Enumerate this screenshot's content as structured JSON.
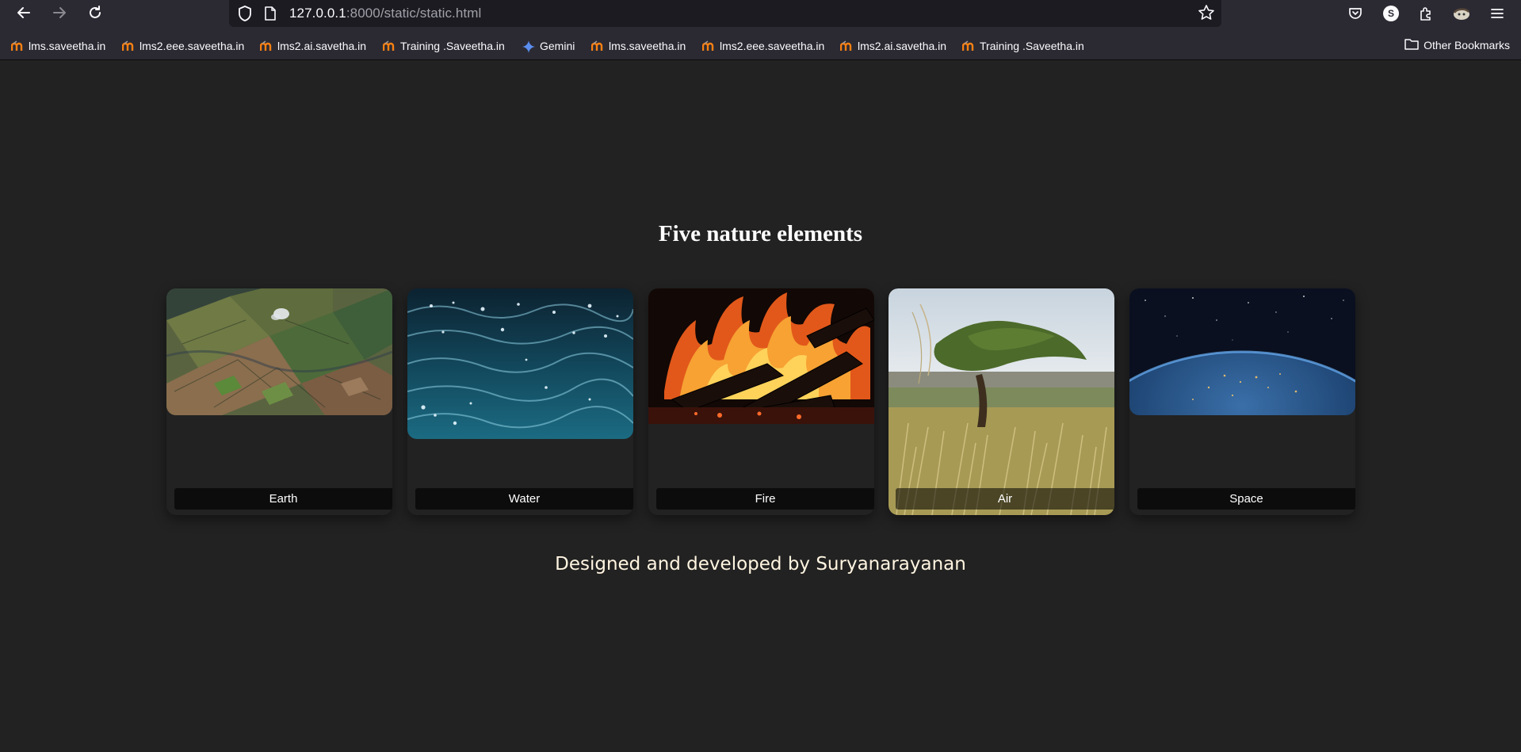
{
  "browser": {
    "url_host": "127.0.0.1",
    "url_rest": ":8000/static/static.html",
    "profile_initial": "S",
    "bookmarks": [
      {
        "label": "lms.saveetha.in",
        "icon": "moodle-icon"
      },
      {
        "label": "lms2.eee.saveetha.in",
        "icon": "moodle-icon"
      },
      {
        "label": "lms2.ai.savetha.in",
        "icon": "moodle-icon"
      },
      {
        "label": "Training .Saveetha.in",
        "icon": "moodle-icon"
      },
      {
        "label": "Gemini",
        "icon": "gemini-sparkle-icon"
      },
      {
        "label": "lms.saveetha.in",
        "icon": "moodle-icon"
      },
      {
        "label": "lms2.eee.saveetha.in",
        "icon": "moodle-icon"
      },
      {
        "label": "lms2.ai.savetha.in",
        "icon": "moodle-icon"
      },
      {
        "label": "Training .Saveetha.in",
        "icon": "moodle-icon"
      }
    ],
    "other_bookmarks": "Other Bookmarks",
    "colors": {
      "chrome": "#2b2a33",
      "urlbar": "#1c1b22",
      "moodle_orange": "#f98012"
    }
  },
  "page": {
    "title": "Five nature elements",
    "background": "#222222",
    "cards": [
      {
        "label": "Earth",
        "image": "aerial farmland photo"
      },
      {
        "label": "Water",
        "image": "ocean water photo"
      },
      {
        "label": "Fire",
        "image": "campfire photo"
      },
      {
        "label": "Air",
        "image": "wind-blown tree photo"
      },
      {
        "label": "Space",
        "image": "earth from space photo"
      }
    ],
    "footer": "Designed and developed by Suryanarayanan"
  }
}
